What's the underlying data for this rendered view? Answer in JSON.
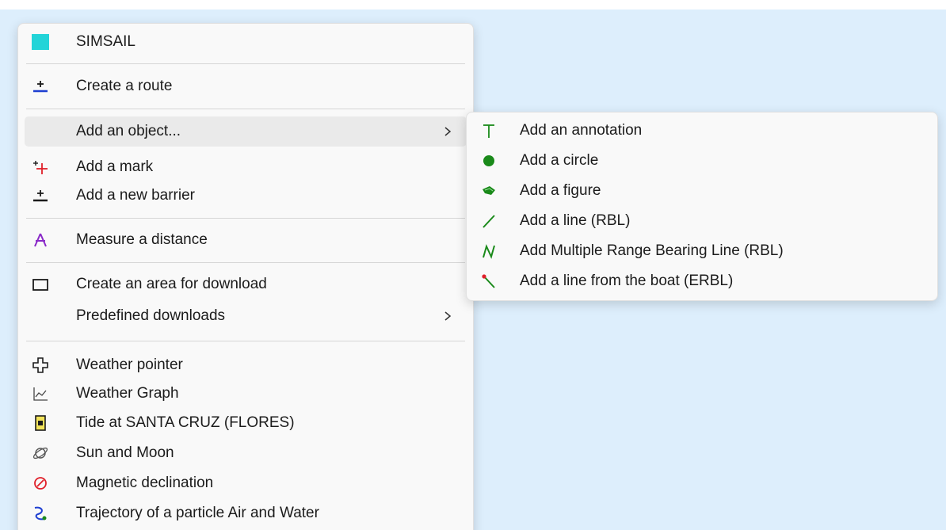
{
  "main_menu": {
    "app_item": {
      "label": "SIMSAIL",
      "icon": "simsail-square-icon",
      "color": "#22d4d8"
    },
    "create_route": {
      "label": "Create a route",
      "icon": "route-icon"
    },
    "add_object": {
      "label": "Add an object...",
      "icon": "none",
      "has_submenu": true
    },
    "add_mark": {
      "label": "Add a mark",
      "icon": "mark-icon"
    },
    "add_barrier": {
      "label": "Add a new barrier",
      "icon": "barrier-icon"
    },
    "measure_distance": {
      "label": "Measure a distance",
      "icon": "compass-icon"
    },
    "create_area": {
      "label": "Create an area for download",
      "icon": "rectangle-icon"
    },
    "predefined_downloads": {
      "label": "Predefined downloads",
      "icon": "none",
      "has_submenu": true
    },
    "weather_pointer": {
      "label": "Weather pointer",
      "icon": "weather-pointer-icon"
    },
    "weather_graph": {
      "label": "Weather Graph",
      "icon": "graph-icon"
    },
    "tide": {
      "label": "Tide at SANTA CRUZ (FLORES)",
      "icon": "tide-icon"
    },
    "sun_moon": {
      "label": "Sun and Moon",
      "icon": "planet-icon"
    },
    "magnetic_declination": {
      "label": "Magnetic declination",
      "icon": "declination-icon"
    },
    "trajectory": {
      "label": "Trajectory of a particle Air and Water",
      "icon": "trajectory-icon"
    }
  },
  "sub_menu": {
    "annotation": {
      "label": "Add an annotation",
      "icon": "text-t-icon"
    },
    "circle": {
      "label": "Add a circle",
      "icon": "circle-icon"
    },
    "figure": {
      "label": "Add a figure",
      "icon": "figure-icon"
    },
    "line": {
      "label": "Add a line (RBL)",
      "icon": "line-icon"
    },
    "multiple_rbl": {
      "label": "Add Multiple Range Bearing Line (RBL)",
      "icon": "multi-line-icon"
    },
    "erbl": {
      "label": "Add a line from the boat (ERBL)",
      "icon": "boat-line-icon"
    }
  },
  "colors": {
    "map_background": "#ddeefc",
    "menu_background": "#f9f9f9",
    "hover": "#eaeaea",
    "accent_green": "#1a8a1a"
  }
}
